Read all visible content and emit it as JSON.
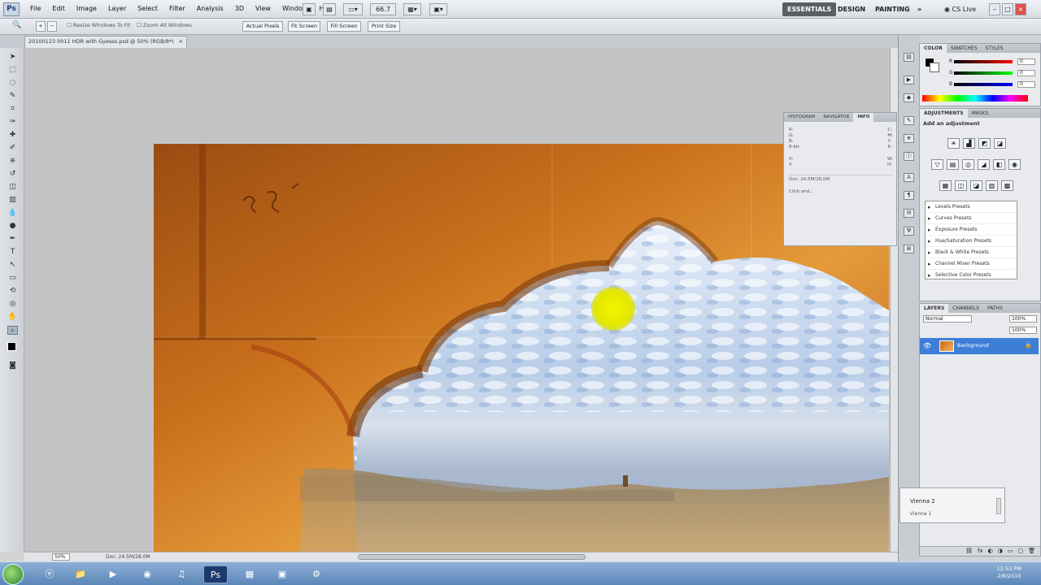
{
  "menubar": {
    "logo": "Ps",
    "items": [
      "File",
      "Edit",
      "Image",
      "Layer",
      "Select",
      "Filter",
      "Analysis",
      "3D",
      "View",
      "Window",
      "Help"
    ],
    "zoom_value": "66.7",
    "workspaces": [
      "ESSENTIALS",
      "DESIGN",
      "PAINTING",
      "»"
    ],
    "cs_live": "CS Live",
    "window_controls": [
      "–",
      "□",
      "×"
    ]
  },
  "options_bar": {
    "resize_windows_label": "Resize Windows To Fit",
    "zoom_all_label": "Zoom All Windows",
    "buttons": [
      "Actual Pixels",
      "Fit Screen",
      "Fill Screen",
      "Print Size"
    ]
  },
  "document": {
    "tab_title": "20100123 0011 HDR with Gyesss.psd @ 50% (RGB/8*)",
    "tab_close": "×"
  },
  "status_bar": {
    "zoom": "50%",
    "doc_size": "Doc: 24.5M/28.0M"
  },
  "color_panel": {
    "tabs": [
      "COLOR",
      "SWATCHES",
      "STYLES"
    ],
    "channels": [
      {
        "label": "R",
        "value": "0"
      },
      {
        "label": "G",
        "value": "0"
      },
      {
        "label": "B",
        "value": "0"
      }
    ]
  },
  "adjustments_panel": {
    "tabs": [
      "ADJUSTMENTS",
      "MASKS"
    ],
    "title": "Add an adjustment",
    "icon_rows": [
      [
        "☀",
        "▟",
        "◩",
        "◪"
      ],
      [
        "▽",
        "▤",
        "◎",
        "◢",
        "◧",
        "◉"
      ],
      [
        "▦",
        "◫",
        "◪",
        "▨",
        "▩"
      ]
    ],
    "presets": [
      "Levels Presets",
      "Curves Presets",
      "Exposure Presets",
      "Hue/Saturation Presets",
      "Black & White Presets",
      "Channel Mixer Presets",
      "Selective Color Presets"
    ]
  },
  "layers_panel": {
    "tabs": [
      "LAYERS",
      "CHANNELS",
      "PATHS"
    ],
    "blend_mode": "Normal",
    "opacity": "100%",
    "fill": "100%",
    "layers": [
      {
        "name": "Background",
        "visible": true
      }
    ]
  },
  "info_panel": {
    "tabs": [
      "HISTOGRAM",
      "NAVIGATOR",
      "INFO"
    ],
    "values": [
      "R:",
      "G:",
      "B:",
      "C:",
      "M:",
      "Y:",
      "K:",
      "8-bit",
      "X:",
      "Y:",
      "W:",
      "H:"
    ],
    "doc_line": "Doc: 24.5M/28.0M",
    "hint": "Click and..."
  },
  "mini_panel": {
    "title": "Vienna 2",
    "sub": "Vienna 1"
  },
  "taskbar": {
    "clock_time": "12:53 PM",
    "clock_date": "2/8/2010"
  },
  "colors": {
    "accent": "#3d7ed8",
    "workspace_active": "#5a5f66",
    "cursor_highlight": "#f3f500"
  }
}
